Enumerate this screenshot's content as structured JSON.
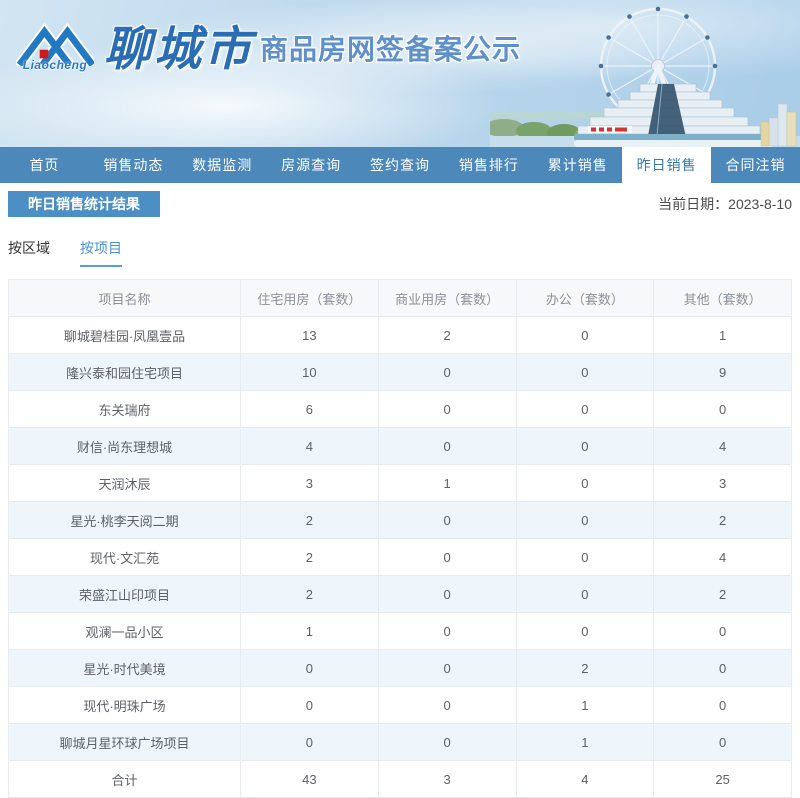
{
  "header": {
    "logo_word": "Liaocheng",
    "city_calligraphy": "聊城市",
    "site_title": "商品房网签备案公示"
  },
  "nav": {
    "items": [
      {
        "label": "首页",
        "active": false
      },
      {
        "label": "销售动态",
        "active": false
      },
      {
        "label": "数据监测",
        "active": false
      },
      {
        "label": "房源查询",
        "active": false
      },
      {
        "label": "签约查询",
        "active": false
      },
      {
        "label": "销售排行",
        "active": false
      },
      {
        "label": "累计销售",
        "active": false
      },
      {
        "label": "昨日销售",
        "active": true
      },
      {
        "label": "合同注销",
        "active": false
      }
    ]
  },
  "section": {
    "title": "昨日销售统计结果",
    "current_date_label": "当前日期：2023-8-10"
  },
  "view_tabs": [
    {
      "label": "按区域",
      "active": false
    },
    {
      "label": "按项目",
      "active": true
    }
  ],
  "table": {
    "columns": [
      "项目名称",
      "住宅用房（套数）",
      "商业用房（套数）",
      "办公（套数）",
      "其他（套数）"
    ],
    "rows": [
      {
        "name": "聊城碧桂园·凤凰壹品",
        "residential": "13",
        "commercial": "2",
        "office": "0",
        "other": "1"
      },
      {
        "name": "隆兴泰和园住宅项目",
        "residential": "10",
        "commercial": "0",
        "office": "0",
        "other": "9"
      },
      {
        "name": "东关瑞府",
        "residential": "6",
        "commercial": "0",
        "office": "0",
        "other": "0"
      },
      {
        "name": "财信·尚东理想城",
        "residential": "4",
        "commercial": "0",
        "office": "0",
        "other": "4"
      },
      {
        "name": "天润沐辰",
        "residential": "3",
        "commercial": "1",
        "office": "0",
        "other": "3"
      },
      {
        "name": "星光·桃李天阅二期",
        "residential": "2",
        "commercial": "0",
        "office": "0",
        "other": "2"
      },
      {
        "name": "现代·文汇苑",
        "residential": "2",
        "commercial": "0",
        "office": "0",
        "other": "4"
      },
      {
        "name": "荣盛江山印项目",
        "residential": "2",
        "commercial": "0",
        "office": "0",
        "other": "2"
      },
      {
        "name": "观澜一品小区",
        "residential": "1",
        "commercial": "0",
        "office": "0",
        "other": "0"
      },
      {
        "name": "星光·时代美境",
        "residential": "0",
        "commercial": "0",
        "office": "2",
        "other": "0"
      },
      {
        "name": "现代·明珠广场",
        "residential": "0",
        "commercial": "0",
        "office": "1",
        "other": "0"
      },
      {
        "name": "聊城月星环球广场项目",
        "residential": "0",
        "commercial": "0",
        "office": "1",
        "other": "0"
      }
    ],
    "total_row": {
      "name": "合计",
      "residential": "43",
      "commercial": "3",
      "office": "4",
      "other": "25"
    }
  },
  "colors": {
    "nav_blue": "#4c88ba",
    "active_nav_text": "#3579b5",
    "band_blue": "#4b8fc4",
    "tab_accent": "#4a90d9",
    "alt_row_bg": "#eef5fb",
    "table_border": "#e7eaee",
    "logo_blue": "#2179c2",
    "logo_red": "#cf1a1a"
  }
}
